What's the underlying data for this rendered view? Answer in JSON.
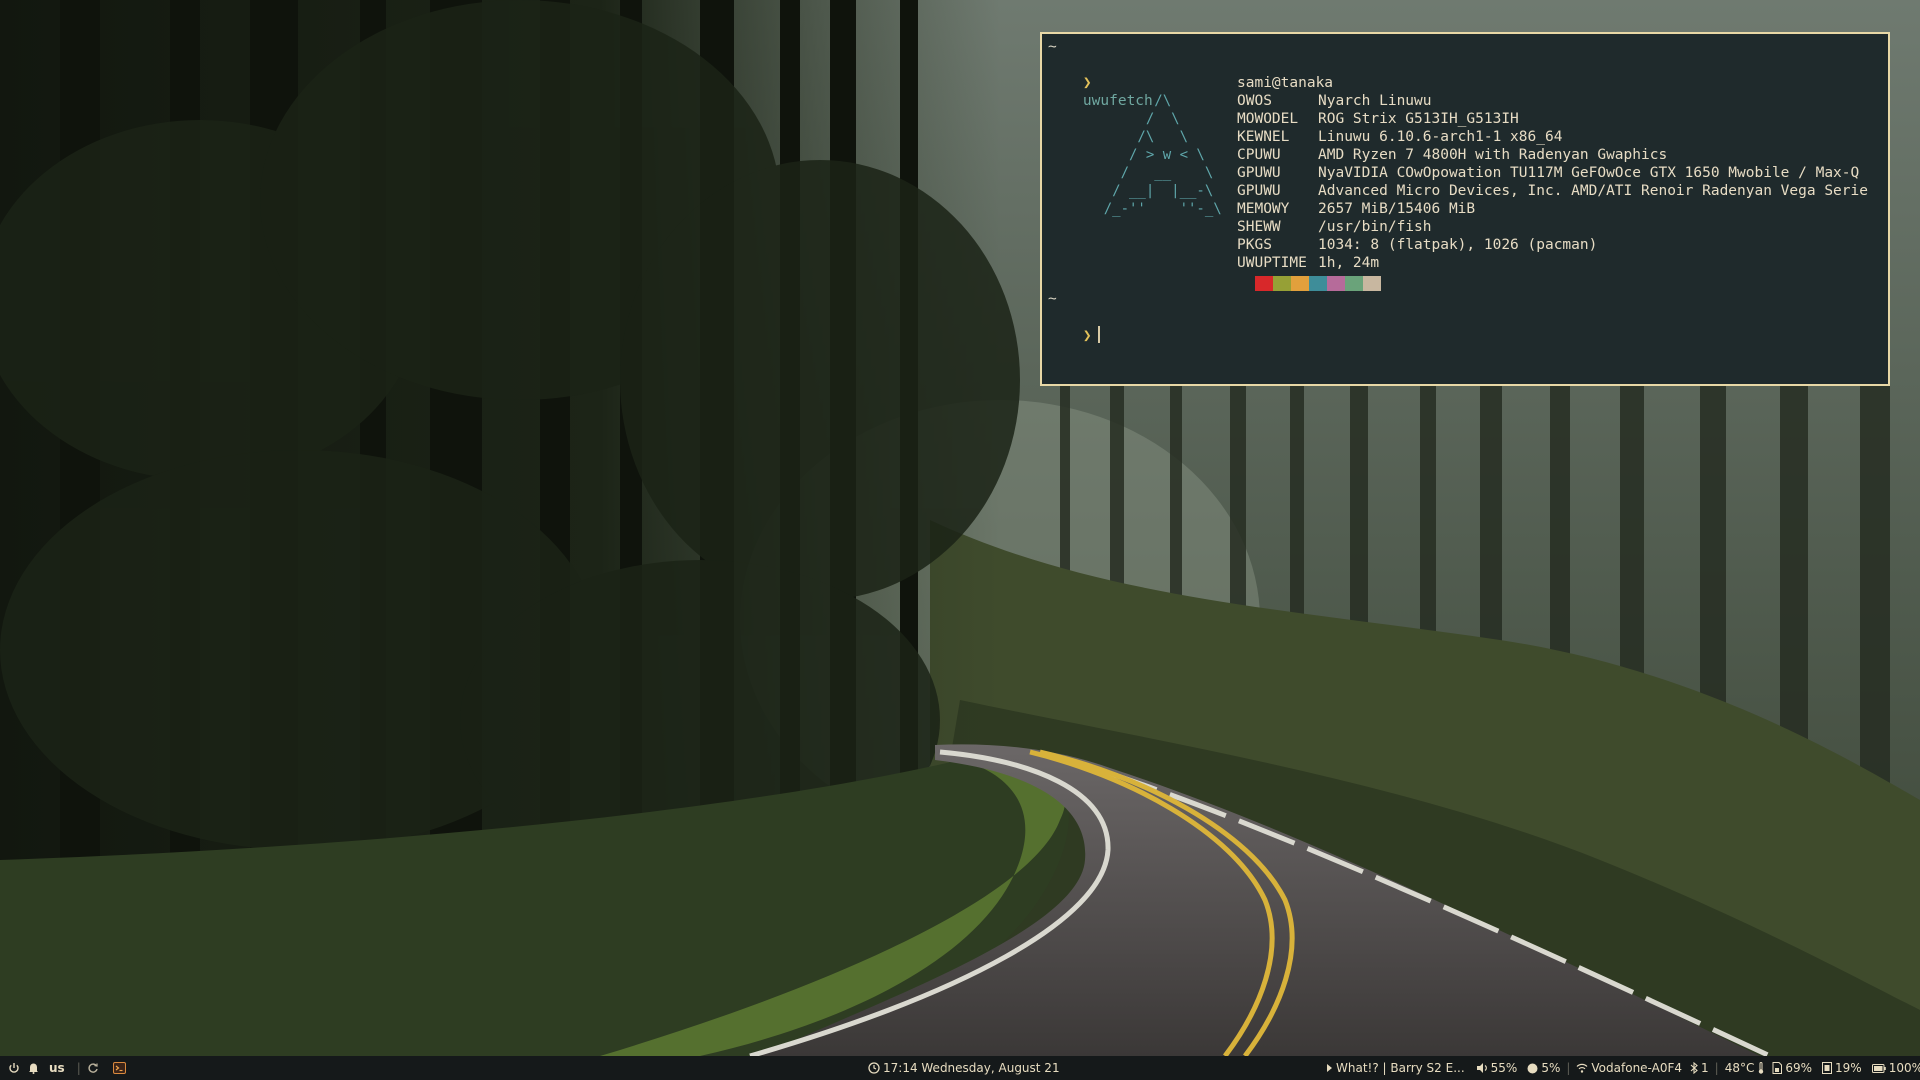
{
  "terminal": {
    "tilde_top": "~",
    "prompt_symbol": "❯",
    "command": "uwufetch",
    "tilde_bottom": "~",
    "logo_ascii": "          /\\\n         /  \\\n        /\\   \\\n       / > w < \\\n      /   __    \\\n     / __|  |__-\\\n    /_-''    ''-_\\",
    "user_host": "sami@tanaka",
    "info": [
      {
        "key": "OWOS",
        "value": "Nyarch Linuwu"
      },
      {
        "key": "MOWODEL",
        "value": "ROG Strix G513IH_G513IH"
      },
      {
        "key": "KEWNEL",
        "value": "Linuwu 6.10.6-arch1-1 x86_64"
      },
      {
        "key": "CPUWU",
        "value": "AMD Ryzen 7 4800H with Radenyan Gwaphics"
      },
      {
        "key": "GPUWU",
        "value": "NyaVIDIA COwOpowation TU117M GeFOwOce GTX 1650 Mwobile / Max-Q"
      },
      {
        "key": "GPUWU",
        "value": "Advanced Micro Devices, Inc. AMD/ATI Renoir Radenyan Vega Serie"
      },
      {
        "key": "MEMOWY",
        "value": "2657 MiB/15406 MiB"
      },
      {
        "key": "SHEWW",
        "value": "/usr/bin/fish"
      },
      {
        "key": "PKGS",
        "value": "1034: 8 (flatpak), 1026 (pacman)"
      },
      {
        "key": "UWUPTIME",
        "value": "1h, 24m"
      }
    ],
    "palette": [
      "#1f2a2c",
      "#d8282a",
      "#96a036",
      "#e2a03c",
      "#3e8d99",
      "#b66b9a",
      "#6aa37a",
      "#c8b7a0"
    ]
  },
  "panel": {
    "left": {
      "power_icon": "power-icon",
      "bell_icon": "bell-icon",
      "keyboard_layout": "us",
      "refresh_icon": "refresh-icon",
      "terminal_icon": "terminal-icon"
    },
    "center": {
      "clock_icon": "clock-icon",
      "datetime": "17:14 Wednesday, August 21"
    },
    "right": {
      "media_title": "What!? | Barry S2 E...",
      "volume": "55%",
      "brightness": "5%",
      "wifi_name": "Vodafone-A0F4",
      "bluetooth_count": "1",
      "temperature": "48°C",
      "memory": "69%",
      "cpu": "19%",
      "battery": "100%"
    }
  },
  "colors": {
    "accent": "#e3c15a",
    "terminal_bg": "#1f2a2c",
    "logo": "#5fa7ab",
    "panel_bg": "#15191a",
    "border": "#e8d8a6"
  }
}
